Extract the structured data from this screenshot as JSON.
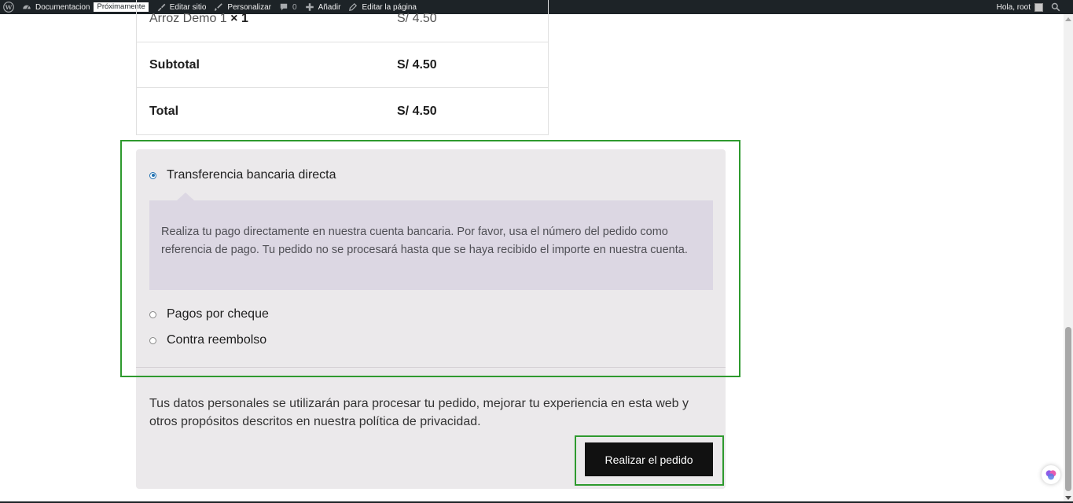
{
  "admin_bar": {
    "site_name": "Documentacion",
    "badge": "Próximamente",
    "edit_site": "Editar sitio",
    "customize": "Personalizar",
    "comments_count": "0",
    "add_new": "Añadir",
    "edit_page": "Editar la página",
    "greeting": "Hola, root"
  },
  "order_review": {
    "product_name": "Arroz Demo 1",
    "product_qty": "× 1",
    "product_total": "S/ 4.50",
    "subtotal_label": "Subtotal",
    "subtotal_value": "S/ 4.50",
    "total_label": "Total",
    "total_value": "S/ 4.50"
  },
  "payment": {
    "methods": [
      {
        "label": "Transferencia bancaria directa",
        "checked": true
      },
      {
        "label": "Pagos por cheque",
        "checked": false
      },
      {
        "label": "Contra reembolso",
        "checked": false
      }
    ],
    "selected_description": "Realiza tu pago directamente en nuestra cuenta bancaria. Por favor, usa el número del pedido como referencia de pago. Tu pedido no se procesará hasta que se haya recibido el importe en nuestra cuenta.",
    "privacy_text": "Tus datos personales se utilizarán para procesar tu pedido, mejorar tu experiencia en esta web y otros propósitos descritos en nuestra política de privacidad.",
    "place_order_label": "Realizar el pedido"
  },
  "colors": {
    "admin_bar_bg": "#1d2327",
    "payment_bg": "#ebe9eb",
    "description_bg": "#dcd7e3",
    "highlight_border": "#2e9a2e",
    "button_bg": "#111111",
    "radio_checked": "#2271b1"
  },
  "icons": [
    "wordpress-icon",
    "dashboard-icon",
    "brush-icon",
    "comment-icon",
    "plus-icon",
    "pencil-icon",
    "search-icon",
    "chat-widget-icon"
  ]
}
